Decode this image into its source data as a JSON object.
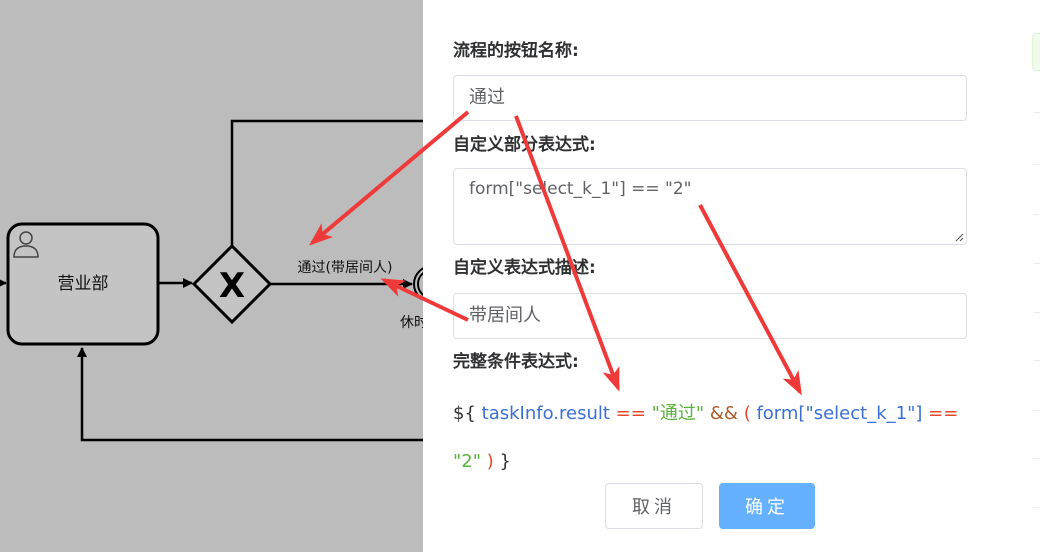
{
  "diagram": {
    "task_label": "营业部",
    "gateway_symbol": "X",
    "flow_label": "通过(带居间人)",
    "partial_label": "休时"
  },
  "panel": {
    "button_name_label": "流程的按钮名称:",
    "button_name_value": "通过",
    "custom_expr_label": "自定义部分表达式:",
    "custom_expr_value": "form[\"select_k_1\"] == \"2\"",
    "expr_desc_label": "自定义表达式描述:",
    "expr_desc_value": "带居间人",
    "full_expr_label": "完整条件表达式:",
    "full_expr": {
      "t1": "${",
      "t2": "taskInfo.result",
      "t3": "==",
      "t4": "\"通过\"",
      "t5": "&&",
      "t6": "(",
      "t7": "form[\"select_k_1\"]",
      "t8": "==",
      "t9": "\"2\"",
      "t10": ")",
      "t11": "}"
    },
    "cancel_label": "取消",
    "ok_label": "确定"
  },
  "colors": {
    "canvas_bg": "#bcbcbc",
    "annotation_arrow": "#f03a3a",
    "primary_button": "#66b1ff"
  }
}
